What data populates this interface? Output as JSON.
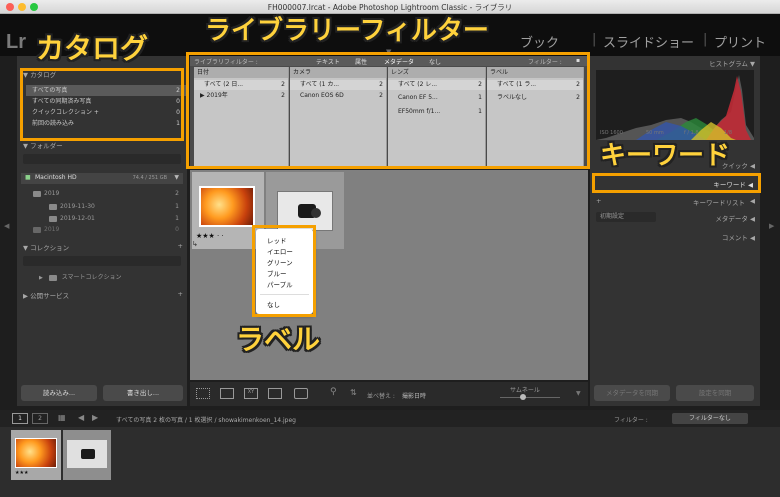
{
  "window": {
    "title": "FH000007.lrcat - Adobe Photoshop Lightroom Classic - ライブラリ"
  },
  "modules": {
    "logo": "Lr",
    "book": "ブック",
    "slideshow": "スライドショー",
    "print": "プリント"
  },
  "left_panel": {
    "catalog_header": "カタログ",
    "catalog_items": [
      {
        "label": "すべての写真",
        "count": "2"
      },
      {
        "label": "すべての同期済み写真",
        "count": "0"
      },
      {
        "label": "クイックコレクション +",
        "count": "0"
      },
      {
        "label": "前回の読み込み",
        "count": "1"
      }
    ],
    "folders_header": "フォルダー",
    "volume": {
      "label": "Macintosh HD",
      "size": "74.4 / 251 GB"
    },
    "folders": [
      {
        "label": "2019",
        "count": "2"
      },
      {
        "label": "2019-11-30",
        "count": "1"
      },
      {
        "label": "2019-12-01",
        "count": "1"
      },
      {
        "label": "2019",
        "count": "0"
      }
    ],
    "collections_header": "コレクション",
    "smart_collection": "スマートコレクション",
    "publish_header": "公開サービス",
    "import_button": "読み込み...",
    "export_button": "書き出し..."
  },
  "library_filter": {
    "label": "ライブラリフィルター :",
    "tabs": [
      "テキスト",
      "属性",
      "メタデータ",
      "なし"
    ],
    "preset_label": "フィルター :",
    "columns": [
      {
        "header": "日付",
        "rows": [
          {
            "label": "すべて (2 日...",
            "count": "2"
          },
          {
            "label": "▶ 2019年",
            "count": "2"
          }
        ]
      },
      {
        "header": "カメラ",
        "rows": [
          {
            "label": "すべて (1 カ...",
            "count": "2"
          },
          {
            "label": "Canon EOS 6D",
            "count": "2"
          }
        ]
      },
      {
        "header": "レンズ",
        "rows": [
          {
            "label": "すべて (2 レ...",
            "count": "2"
          },
          {
            "label": "Canon EF 5...",
            "count": "1"
          },
          {
            "label": "EF50mm f/1...",
            "count": "1"
          }
        ]
      },
      {
        "header": "ラベル",
        "rows": [
          {
            "label": "すべて (1 ラ...",
            "count": "2"
          },
          {
            "label": "ラベルなし",
            "count": "2"
          }
        ]
      }
    ]
  },
  "grid": {
    "rating_stars": "★★★ · ·"
  },
  "context_menu": {
    "items": [
      "レッド",
      "イエロー",
      "グリーン",
      "ブルー",
      "パープル"
    ],
    "none": "なし"
  },
  "right_panel": {
    "histogram": "ヒストグラム",
    "iso": "ISO 1600",
    "focal": "50 mm",
    "aperture": "f / 1.8",
    "shutter": "1/8",
    "quick_develop": "クイック",
    "keyword_header": "キーワード",
    "keyword_list": "キーワードリスト",
    "preset": "初期設定",
    "metadata": "メタデータ",
    "comments": "コメント",
    "sync_metadata": "メタデータを同期",
    "sync_settings": "設定を同期"
  },
  "toolbar": {
    "sort_label": "並べ替え :",
    "sort_value": "撮影日時",
    "thumbnail_label": "サムネール"
  },
  "filmbar": {
    "page1": "1",
    "page2": "2",
    "path": "すべての写真  2 枚の写真 / 1 枚選択 / showakimenkoen_14.jpeg",
    "filter_label": "フィルター :",
    "filter_value": "フィルターなし"
  },
  "annotations": {
    "catalog": "カタログ",
    "library_filter": "ライブラリーフィルター",
    "keyword": "キーワード",
    "label": "ラベル"
  },
  "colors": {
    "accent_orange": "#f5a000",
    "annotation_text": "#ffd23c"
  }
}
